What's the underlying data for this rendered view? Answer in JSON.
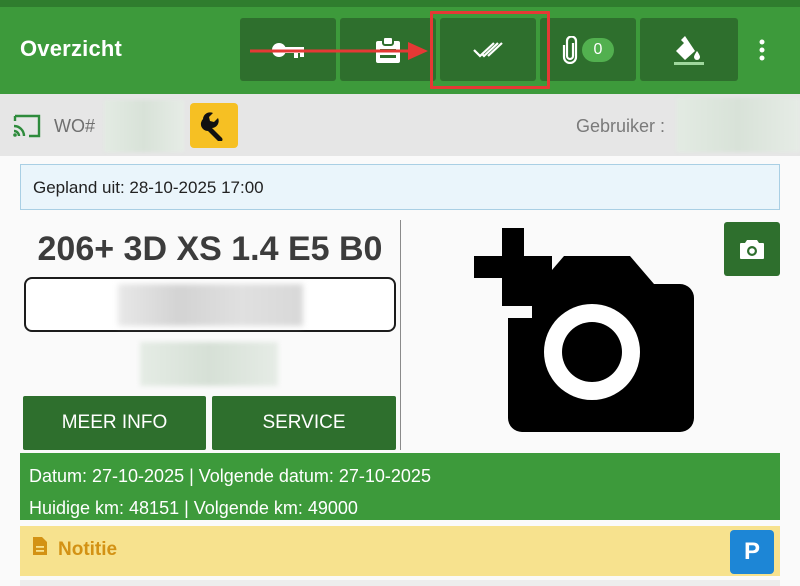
{
  "appbar": {
    "title": "Overzicht",
    "attachments_count": "0",
    "icons": [
      "key-icon",
      "clipboard-icon",
      "double-check-icon",
      "paperclip-icon",
      "paint-bucket-icon",
      "more-vert-icon"
    ]
  },
  "wo": {
    "label": "WO#",
    "user_label": "Gebruiker :"
  },
  "planned": {
    "text": "Gepland uit: 28-10-2025 17:00"
  },
  "vehicle": {
    "model": "206+ 3D XS 1.4 E5 B0",
    "meer_info_label": "MEER INFO",
    "service_label": "SERVICE"
  },
  "info": {
    "line1": "Datum: 27-10-2025 | Volgende datum: 27-10-2025",
    "line2": "Huidige km: 48151 | Volgende km: 49000"
  },
  "note": {
    "label": "Notitie",
    "p_label": "P"
  },
  "colors": {
    "primary_green": "#3d9a3b",
    "dark_green": "#2e6f2d",
    "highlight_red": "#e53935",
    "wrench_yellow": "#f6c023",
    "note_yellow": "#f7e28e",
    "note_text": "#d39214",
    "p_blue": "#1d86d6"
  }
}
